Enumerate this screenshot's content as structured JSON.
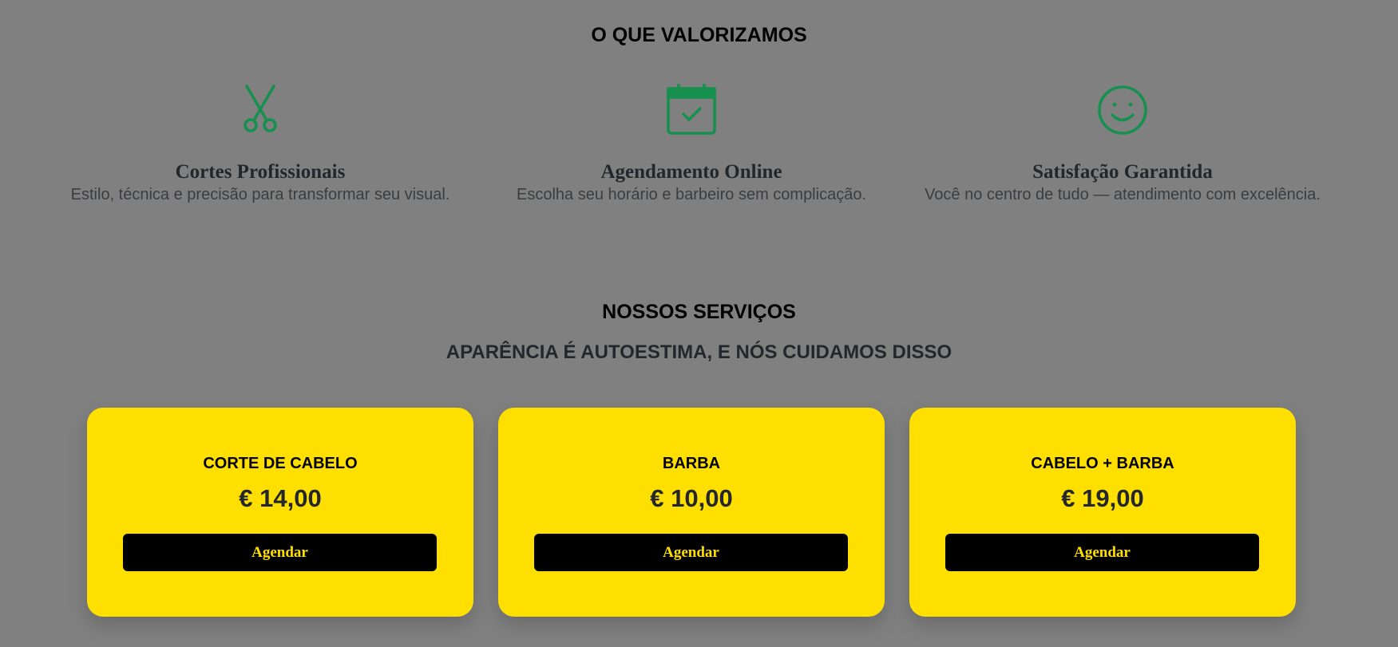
{
  "values": {
    "title": "O QUE VALORIZAMOS",
    "items": [
      {
        "icon": "scissors-icon",
        "heading": "Cortes Profissionais",
        "description": "Estilo, técnica e precisão para transformar seu visual."
      },
      {
        "icon": "calendar-check-icon",
        "heading": "Agendamento Online",
        "description": "Escolha seu horário e barbeiro sem complicação."
      },
      {
        "icon": "smiley-icon",
        "heading": "Satisfação Garantida",
        "description": "Você no centro de tudo — atendimento com excelência."
      }
    ]
  },
  "services": {
    "title": "NOSSOS SERVIÇOS",
    "subtitle": "APARÊNCIA É AUTOESTIMA, E NÓS CUIDAMOS DISSO",
    "cards": [
      {
        "name": "CORTE DE CABELO",
        "price": "€ 14,00",
        "button_label": "Agendar"
      },
      {
        "name": "BARBA",
        "price": "€ 10,00",
        "button_label": "Agendar"
      },
      {
        "name": "CABELO + BARBA",
        "price": "€ 19,00",
        "button_label": "Agendar"
      }
    ]
  },
  "colors": {
    "background": "#808080",
    "accent_green": "#17904f",
    "card_yellow": "#ffdf00",
    "button_black": "#000000",
    "text_dark": "#23272b"
  }
}
